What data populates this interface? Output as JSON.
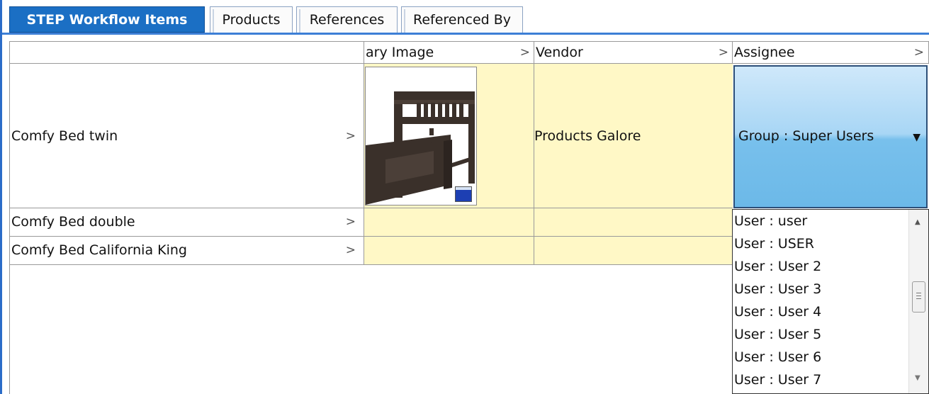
{
  "tabs": [
    {
      "label": "STEP Workflow Items",
      "active": true
    },
    {
      "label": "Products",
      "active": false
    },
    {
      "label": "References",
      "active": false
    },
    {
      "label": "Referenced By",
      "active": false
    }
  ],
  "columns": {
    "primary_image": "ary Image",
    "vendor": "Vendor",
    "assignee": "Assignee"
  },
  "rows": [
    {
      "name": "Comfy Bed twin",
      "vendor": "Products Galore",
      "assignee": "Group : Super Users"
    },
    {
      "name": "Comfy Bed double",
      "vendor": "",
      "assignee": ""
    },
    {
      "name": "Comfy Bed California King",
      "vendor": "",
      "assignee": ""
    }
  ],
  "assignee_options": [
    "User : user",
    "User : USER",
    "User : User 2",
    "User : User 3",
    "User : User 4",
    "User : User 5",
    "User : User 6",
    "User : User 7"
  ],
  "icons": {
    "chevron": "chevron-right-icon",
    "dropdown": "caret-down-icon",
    "scroll_up": "scroll-up-icon",
    "scroll_down": "scroll-down-icon",
    "image_badge": "image-window-icon"
  },
  "colors": {
    "active_tab": "#1b6fc4",
    "tab_underline": "#3d7fd6",
    "editable_cell": "#fff8c6",
    "assignee_highlight": "#78c0ec"
  }
}
